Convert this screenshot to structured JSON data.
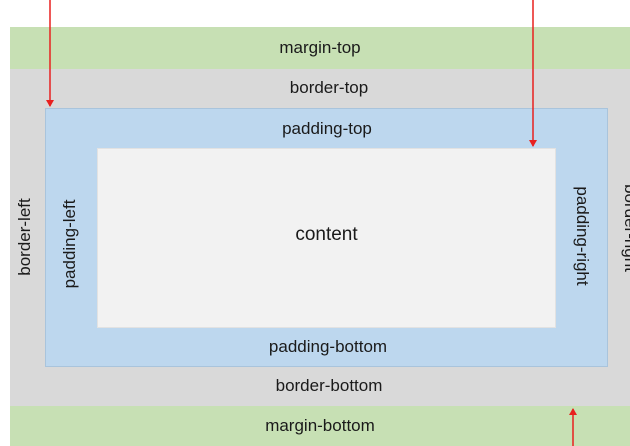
{
  "labels": {
    "margin_top": "margin-top",
    "margin_bottom": "margin-bottom",
    "border_top": "border-top",
    "border_bottom": "border-bottom",
    "border_left": "border-left",
    "border_right": "border-right",
    "padding_top": "padding-top",
    "padding_bottom": "padding-bottom",
    "padding_left": "padding-left",
    "padding_right": "padding-right",
    "content": "content"
  },
  "colors": {
    "margin": "#c7e0b4",
    "border": "#d9d9d9",
    "padding": "#bdd7ee",
    "content": "#f2f2f2",
    "arrow": "#e8201f"
  }
}
